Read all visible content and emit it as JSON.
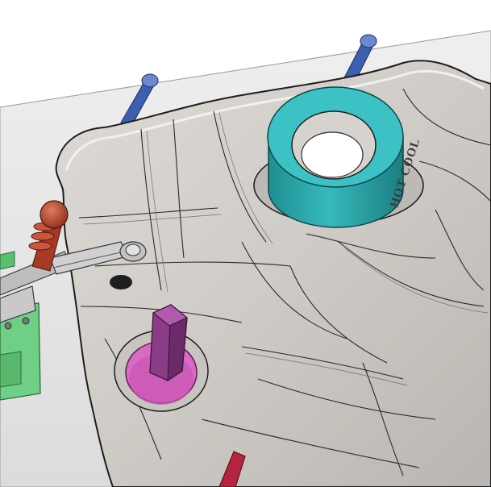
{
  "scene": {
    "engraved_text": "HOT COOL",
    "colors": {
      "background": "#ffffff",
      "fixture_plate": "#e6e6e6",
      "casting": "#cfcbc6",
      "casting_edge": "#1e1e1e",
      "teal_ring": "#27a8aa",
      "pink_part": "#d86cc4",
      "purple_post": "#8a3d86",
      "blue_pins": "#3d5fb0",
      "red_handle": "#b8452e",
      "green_block": "#6fcf84",
      "clamp_metal": "#b9b9b9",
      "crimson_rod": "#b6243f"
    },
    "objects": [
      "fixture-plate",
      "casting-part",
      "teal-ring",
      "pink-fitting",
      "purple-hex-post",
      "blue-locating-pins",
      "toggle-clamp",
      "green-support-block",
      "crimson-rod"
    ]
  }
}
